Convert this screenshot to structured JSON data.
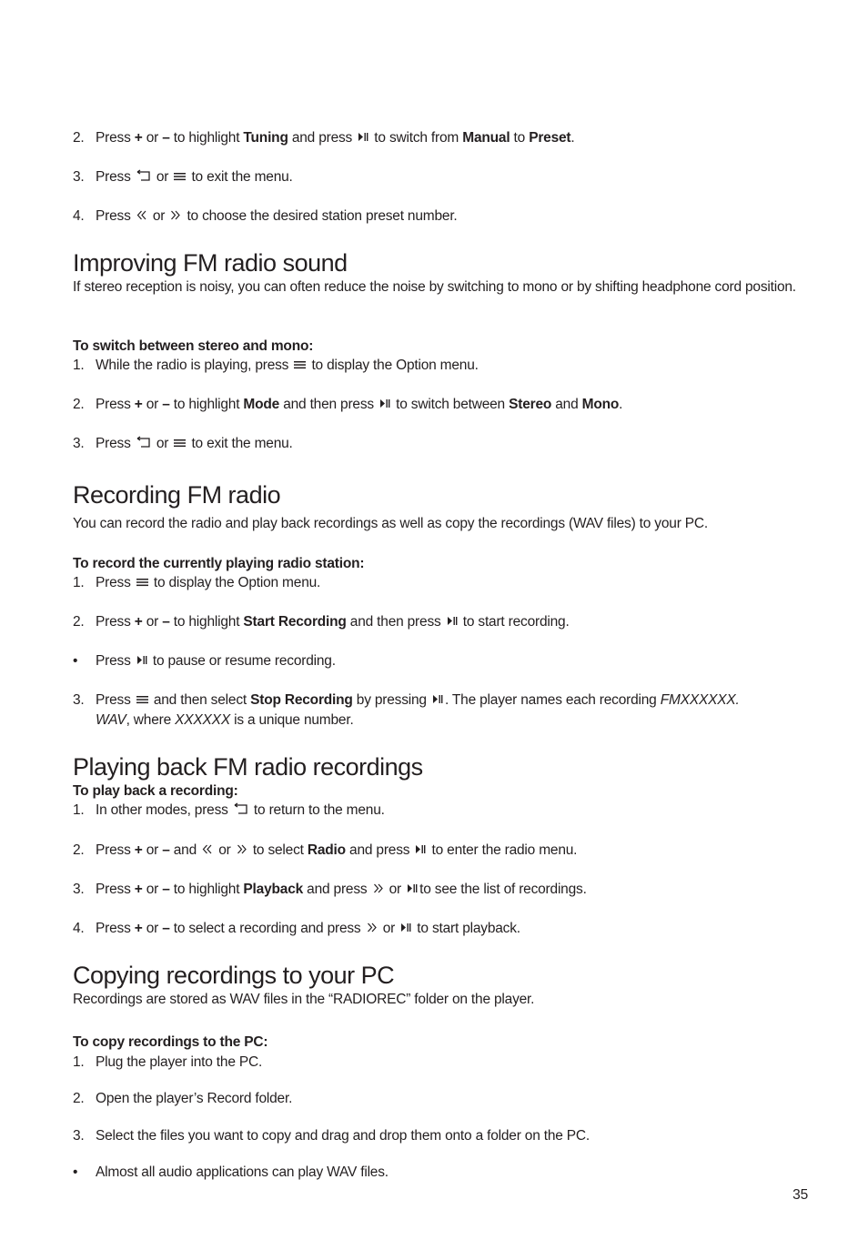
{
  "intro_steps": [
    {
      "num": "2.",
      "parts": [
        "Press ",
        {
          "b": "+"
        },
        " or ",
        {
          "b": "–"
        },
        " to highlight ",
        {
          "b": "Tuning"
        },
        " and press ",
        {
          "icon": "play-pause"
        },
        " to switch from ",
        {
          "b": "Manual"
        },
        " to ",
        {
          "b": "Preset"
        },
        "."
      ]
    },
    {
      "num": "3.",
      "parts": [
        "Press ",
        {
          "icon": "back"
        },
        " or ",
        {
          "icon": "menu"
        },
        " to exit the menu."
      ]
    },
    {
      "num": "4.",
      "parts": [
        "Press ",
        {
          "icon": "rewind"
        },
        " or ",
        {
          "icon": "forward"
        },
        " to choose the desired station preset number."
      ]
    }
  ],
  "sections": {
    "improving": {
      "title": "Improving FM radio sound",
      "intro": "If stereo reception is noisy, you can often reduce the noise by switching to mono or by shifting headphone cord position.",
      "subheading": "To switch between stereo and mono:",
      "steps": [
        {
          "num": "1.",
          "parts": [
            "While the radio is playing, press ",
            {
              "icon": "menu"
            },
            " to display the Option menu."
          ]
        },
        {
          "num": "2.",
          "parts": [
            "Press ",
            {
              "b": "+"
            },
            " or ",
            {
              "b": "–"
            },
            " to highlight ",
            {
              "b": "Mode"
            },
            " and then press ",
            {
              "icon": "play-pause"
            },
            " to switch between ",
            {
              "b": "Stereo"
            },
            " and ",
            {
              "b": "Mono"
            },
            "."
          ]
        },
        {
          "num": "3.",
          "parts": [
            "Press ",
            {
              "icon": "back"
            },
            " or ",
            {
              "icon": "menu"
            },
            " to exit the menu."
          ]
        }
      ]
    },
    "recording": {
      "title": "Recording FM radio",
      "intro": "You can record the radio and play back recordings as well as copy the recordings (WAV files) to your PC.",
      "subheading": "To record the currently playing radio station:",
      "steps": [
        {
          "num": "1.",
          "parts": [
            "Press ",
            {
              "icon": "menu"
            },
            " to display the Option menu."
          ]
        },
        {
          "num": "2.",
          "parts": [
            "Press ",
            {
              "b": "+"
            },
            " or ",
            {
              "b": "–"
            },
            " to highlight ",
            {
              "b": "Start Recording"
            },
            " and then press ",
            {
              "icon": "play-pause"
            },
            " to start recording."
          ]
        },
        {
          "num": "•",
          "parts": [
            "Press ",
            {
              "icon": "play-pause"
            },
            " to pause or resume recording."
          ]
        },
        {
          "num": "3.",
          "parts": [
            "Press ",
            {
              "icon": "menu"
            },
            " and then select ",
            {
              "b": "Stop Recording"
            },
            " by pressing ",
            {
              "icon": "play-pause"
            },
            ". The player names each recording ",
            {
              "i": "FMXXXXXX."
            }
          ],
          "cont": [
            {
              "i": "WAV"
            },
            ", where ",
            {
              "i": "XXXXXX"
            },
            " is a unique number."
          ]
        }
      ]
    },
    "playback": {
      "title": "Playing back FM radio recordings",
      "subheading": "To play back a recording:",
      "steps": [
        {
          "num": "1.",
          "parts": [
            "In other modes, press ",
            {
              "icon": "back"
            },
            " to return to the menu."
          ]
        },
        {
          "num": "2.",
          "parts": [
            "Press ",
            {
              "b": "+"
            },
            " or ",
            {
              "b": "–"
            },
            " and ",
            {
              "icon": "rewind"
            },
            " or ",
            {
              "icon": "forward"
            },
            " to select ",
            {
              "b": "Radio"
            },
            " and press ",
            {
              "icon": "play-pause"
            },
            " to enter the radio menu."
          ]
        },
        {
          "num": "3.",
          "parts": [
            "Press ",
            {
              "b": "+"
            },
            " or ",
            {
              "b": "–"
            },
            " to highlight ",
            {
              "b": "Playback"
            },
            " and press ",
            {
              "icon": "forward"
            },
            " or ",
            {
              "icon": "play-pause"
            },
            "to see the list of recordings."
          ]
        },
        {
          "num": "4.",
          "parts": [
            "Press ",
            {
              "b": "+"
            },
            " or ",
            {
              "b": "–"
            },
            " to select a recording and press ",
            {
              "icon": "forward"
            },
            " or ",
            {
              "icon": "play-pause"
            },
            " to start playback."
          ]
        }
      ]
    },
    "copying": {
      "title": "Copying recordings to your PC",
      "intro": "Recordings are stored as WAV files in the “RADIOREC” folder on the player.",
      "subheading": "To copy recordings to the PC:",
      "steps": [
        {
          "num": "1.",
          "parts": [
            "Plug the player into the PC."
          ]
        },
        {
          "num": "2.",
          "parts": [
            "Open the player’s Record folder."
          ]
        },
        {
          "num": "3.",
          "parts": [
            "Select the files you want to copy and drag and drop them onto a folder on the PC."
          ]
        },
        {
          "num": "•",
          "parts": [
            "Almost all audio applications can play WAV files."
          ]
        }
      ]
    }
  },
  "page_number": "35"
}
